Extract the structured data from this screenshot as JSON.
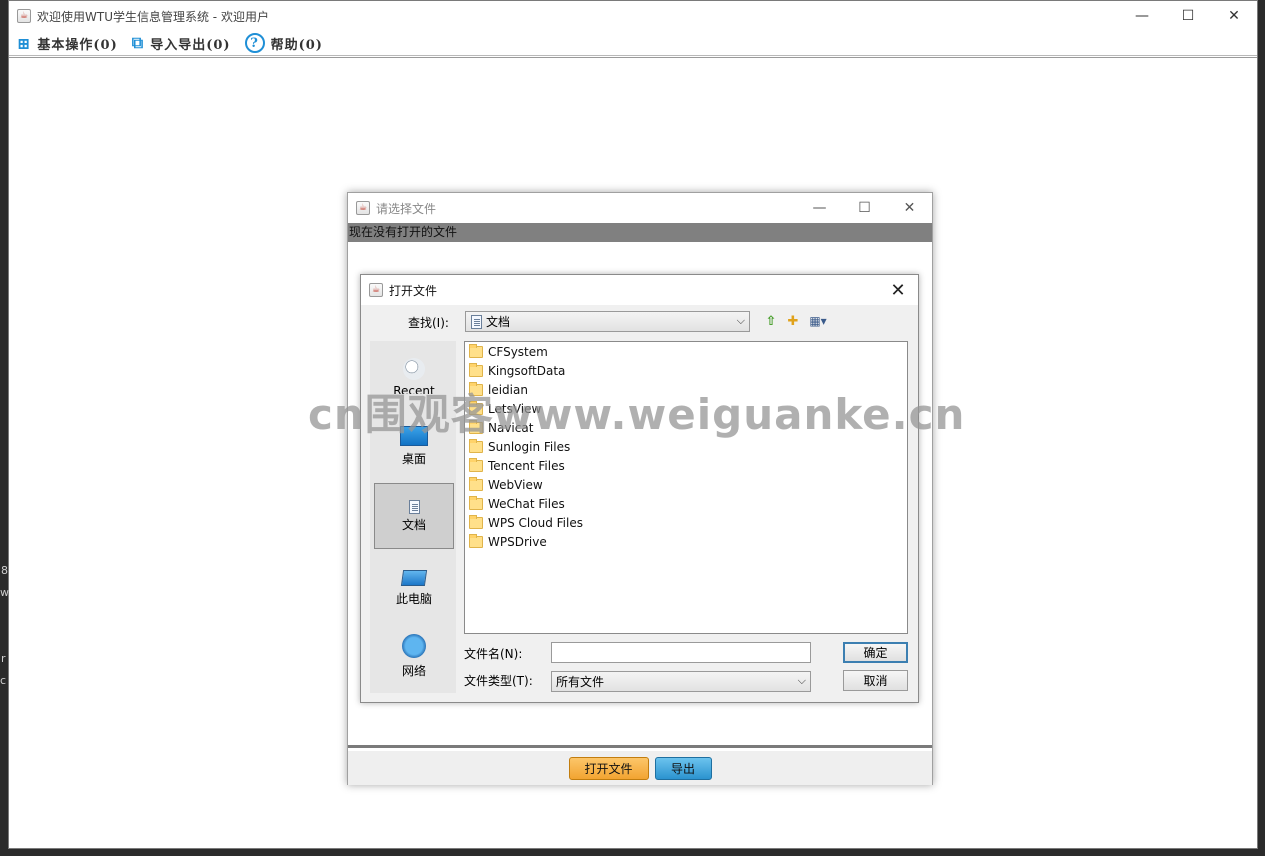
{
  "main_window": {
    "title": "欢迎使用WTU学生信息管理系统 - 欢迎用户",
    "controls": {
      "minimize": "—",
      "maximize": "☐",
      "close": "✕"
    },
    "menu": [
      {
        "label": "基本操作(0)",
        "icon": "plus-square-icon",
        "glyph": "⊞"
      },
      {
        "label": "导入导出(0)",
        "icon": "import-export-icon",
        "glyph": "⧉"
      },
      {
        "label": "帮助(0)",
        "icon": "help-circle-icon",
        "glyph": "?"
      }
    ]
  },
  "edge_text": [
    "8",
    "w",
    "r",
    "c"
  ],
  "select_window": {
    "title": "请选择文件",
    "status": "现在没有打开的文件",
    "controls": {
      "minimize": "—",
      "maximize": "☐",
      "close": "✕"
    },
    "buttons": {
      "open_file": "打开文件",
      "export": "导出"
    }
  },
  "open_dialog": {
    "title": "打开文件",
    "close": "✕",
    "lookin_label": "查找(I):",
    "lookin_value": "文档",
    "toolbar": {
      "up": "⇧",
      "new_folder": "✚",
      "view": "▦▾"
    },
    "places": [
      {
        "label": "Recent",
        "icon": "recent-items-icon",
        "selected": false
      },
      {
        "label": "桌面",
        "icon": "desktop-icon",
        "selected": false
      },
      {
        "label": "文档",
        "icon": "documents-icon",
        "selected": true
      },
      {
        "label": "此电脑",
        "icon": "computer-icon",
        "selected": false
      },
      {
        "label": "网络",
        "icon": "network-icon",
        "selected": false
      }
    ],
    "files": [
      "CFSystem",
      "KingsoftData",
      "leidian",
      "LetsView",
      "Navicat",
      "Sunlogin Files",
      "Tencent Files",
      "WebView",
      "WeChat Files",
      "WPS Cloud Files",
      "WPSDrive"
    ],
    "file_name_label": "文件名(N):",
    "file_name_value": "",
    "file_type_label": "文件类型(T):",
    "file_type_value": "所有文件",
    "ok_label": "确定",
    "cancel_label": "取消"
  },
  "watermark": "cn围观客www.weiguanke.cn"
}
